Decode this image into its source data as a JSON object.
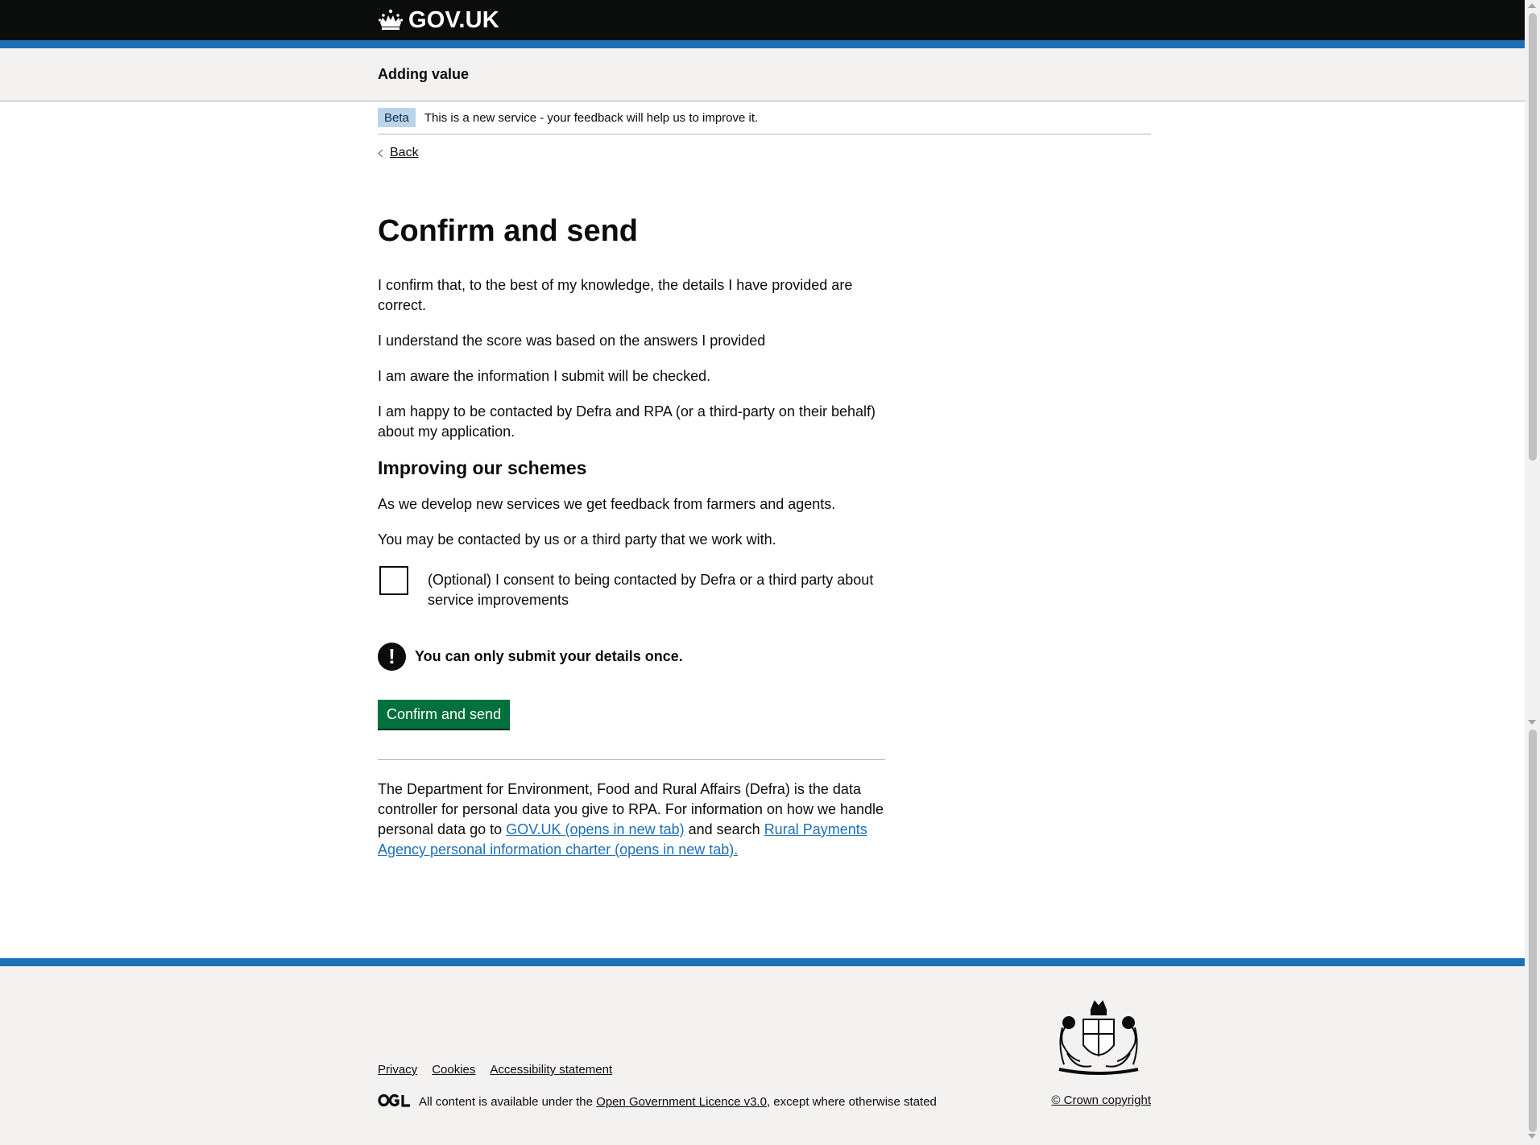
{
  "header": {
    "logo_text": "GOV.UK",
    "service_name": "Adding value"
  },
  "phase_banner": {
    "tag": "Beta",
    "text": "This is a new service - your feedback will help us to improve it."
  },
  "back_link": "Back",
  "main": {
    "title": "Confirm and send",
    "paragraphs": [
      "I confirm that, to the best of my knowledge, the details I have provided are correct.",
      "I understand the score was based on the answers I provided",
      "I am aware the information I submit will be checked.",
      "I am happy to be contacted by Defra and RPA (or a third-party on their behalf) about my application."
    ],
    "subheading": "Improving our schemes",
    "scheme_paragraphs": [
      "As we develop new services we get feedback from farmers and agents.",
      "You may be contacted by us or a third party that we work with."
    ],
    "consent_checkbox_label": "(Optional) I consent to being contacted by Defra or a third party about service improvements",
    "consent_checked": false,
    "warning_icon": "!",
    "warning_text": "You can only submit your details once.",
    "submit_button": "Confirm and send",
    "privacy_text_1": "The Department for Environment, Food and Rural Affairs (Defra) is the data controller for personal data you give to RPA. For information on how we handle personal data go to",
    "privacy_link_1": "GOV.UK (opens in new tab)",
    "privacy_text_2": "and search",
    "privacy_link_2": "Rural Payments Agency personal information charter (opens in new tab)."
  },
  "footer": {
    "links": [
      "Privacy",
      "Cookies",
      "Accessibility statement"
    ],
    "licence_prefix": "All content is available under the",
    "licence_link": "Open Government Licence v3.0",
    "licence_suffix": ", except where otherwise stated",
    "copyright": "© Crown copyright"
  },
  "colors": {
    "header_bg": "#0b0c0c",
    "brand_blue": "#1d70b8",
    "button_green": "#00703c",
    "footer_bg": "#f3f2f1",
    "beta_tag_bg": "#bbd4ea"
  }
}
